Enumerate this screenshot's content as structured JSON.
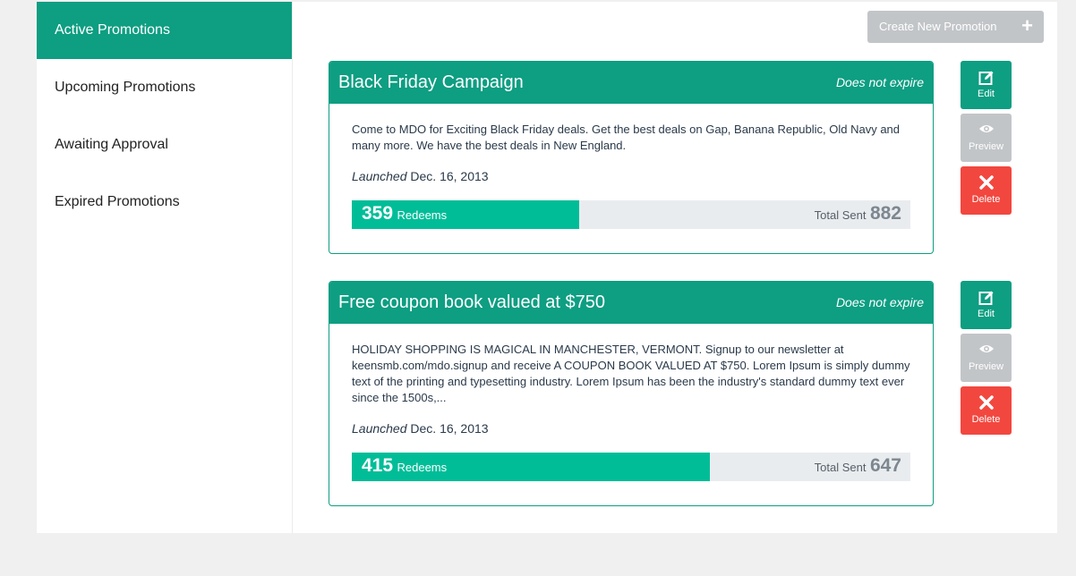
{
  "sidebar": {
    "items": [
      {
        "label": "Active Promotions",
        "active": true
      },
      {
        "label": "Upcoming Promotions",
        "active": false
      },
      {
        "label": "Awaiting Approval",
        "active": false
      },
      {
        "label": "Expired Promotions",
        "active": false
      }
    ]
  },
  "toolbar": {
    "create_label": "Create New Promotion",
    "create_icon": "plus-icon"
  },
  "promotions": [
    {
      "title": "Black Friday Campaign",
      "expiry": "Does not expire",
      "description": "Come to MDO for Exciting Black Friday deals. Get the best deals on Gap, Banana Republic, Old Navy and many more. We have the best deals in New England.",
      "launched_label": "Launched",
      "launched_date": "Dec. 16, 2013",
      "redeems": "359",
      "redeems_label": "Redeems",
      "total_label": "Total Sent",
      "total_sent": "882",
      "redeem_fraction": 0.407
    },
    {
      "title": "Free coupon book valued at $750",
      "expiry": "Does not expire",
      "description": "HOLIDAY SHOPPING IS MAGICAL IN MANCHESTER, VERMONT. Signup to our newsletter at keensmb.com/mdo.signup and receive A COUPON BOOK VALUED AT $750. Lorem Ipsum is simply dummy text of the printing and typesetting industry. Lorem Ipsum has been the industry's standard dummy text ever since the 1500s,...",
      "launched_label": "Launched",
      "launched_date": "Dec. 16, 2013",
      "redeems": "415",
      "redeems_label": "Redeems",
      "total_label": "Total Sent",
      "total_sent": "647",
      "redeem_fraction": 0.6414
    }
  ],
  "actions": {
    "edit_label": "Edit",
    "preview_label": "Preview",
    "delete_label": "Delete",
    "edit_icon": "edit-icon",
    "preview_icon": "eye-icon",
    "delete_icon": "close-icon"
  },
  "colors": {
    "accent": "#0e9e82",
    "progress": "#00bd98",
    "danger": "#f2473f",
    "disabled": "#c2c5c8"
  }
}
